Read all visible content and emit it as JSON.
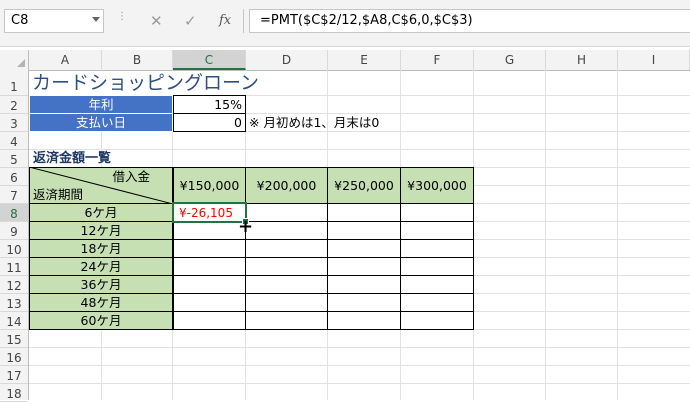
{
  "formula_bar": {
    "name_box": "C8",
    "cancel_icon": "✕",
    "enter_icon": "✓",
    "fx_icon": "fx",
    "formula": "=PMT($C$2/12,$A8,C$6,0,$C$3)"
  },
  "columns": [
    "A",
    "B",
    "C",
    "D",
    "E",
    "F",
    "G",
    "H",
    "I"
  ],
  "rows": [
    "1",
    "2",
    "3",
    "4",
    "5",
    "6",
    "7",
    "8",
    "9",
    "10",
    "11",
    "12",
    "13",
    "14",
    "15",
    "16",
    "17",
    "18"
  ],
  "active": {
    "column": "C",
    "row": "8"
  },
  "sheet": {
    "title": "カードショッピングローン",
    "rate_label": "年利",
    "rate_value": "15%",
    "payday_label": "支払い日",
    "payday_value": "0",
    "payday_note": "※ 月初めは1、月末は0",
    "table_title": "返済金額一覧",
    "header_borrow": "借入金",
    "header_period": "返済期間",
    "amounts": [
      "¥150,000",
      "¥200,000",
      "¥250,000",
      "¥300,000"
    ],
    "periods": [
      "6ケ月",
      "12ケ月",
      "18ケ月",
      "24ケ月",
      "36ケ月",
      "48ケ月",
      "60ケ月"
    ],
    "result_c8": "¥-26,105"
  },
  "colors": {
    "header_blue": "#4472c4",
    "table_green": "#c6e0b4",
    "negative_red": "#ff0000",
    "selection_green": "#217346"
  }
}
